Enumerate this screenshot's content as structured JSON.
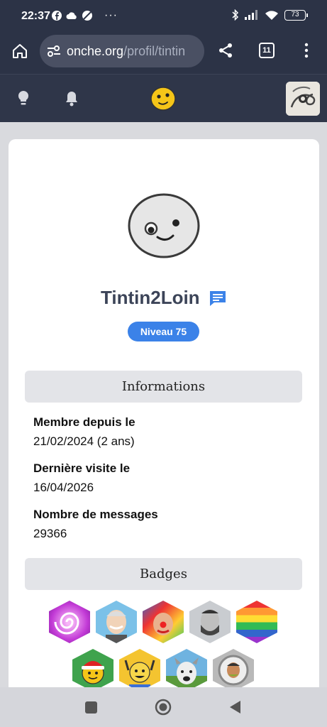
{
  "status_bar": {
    "time": "22:37",
    "battery": "73"
  },
  "browser": {
    "url_domain": "onche.org",
    "url_path": "/profil/tintin",
    "tab_count": "11"
  },
  "profile": {
    "username": "Tintin2Loin",
    "level": "Niveau 75"
  },
  "informations": {
    "heading": "Informations",
    "fields": [
      {
        "label": "Membre depuis le",
        "value": "21/02/2024 (2 ans)"
      },
      {
        "label": "Dernière visite le",
        "value": "16/04/2026"
      },
      {
        "label": "Nombre de messages",
        "value": "29366"
      }
    ]
  },
  "badges": {
    "heading": "Badges",
    "items": [
      {
        "icon": "spiral-badge-icon",
        "color": "#c23ad6"
      },
      {
        "icon": "smiling-man-badge-icon",
        "color": "#7bc1e8"
      },
      {
        "icon": "clown-badge-icon",
        "color": "#e44b3a"
      },
      {
        "icon": "bearded-man-badge-icon",
        "color": "#9aa0a6"
      },
      {
        "icon": "rainbow-badge-icon",
        "color": "#f2a23a"
      },
      {
        "icon": "santa-smiley-badge-icon",
        "color": "#3fa34d"
      },
      {
        "icon": "cheering-smiley-badge-icon",
        "color": "#f4c430"
      },
      {
        "icon": "dog-badge-icon",
        "color": "#6fb3e0"
      },
      {
        "icon": "man-portrait-badge-icon",
        "color": "#b9b9b9"
      }
    ]
  },
  "colors": {
    "header_bg": "#2c3346",
    "accent": "#3b82e8",
    "page_bg": "#d9dade"
  }
}
